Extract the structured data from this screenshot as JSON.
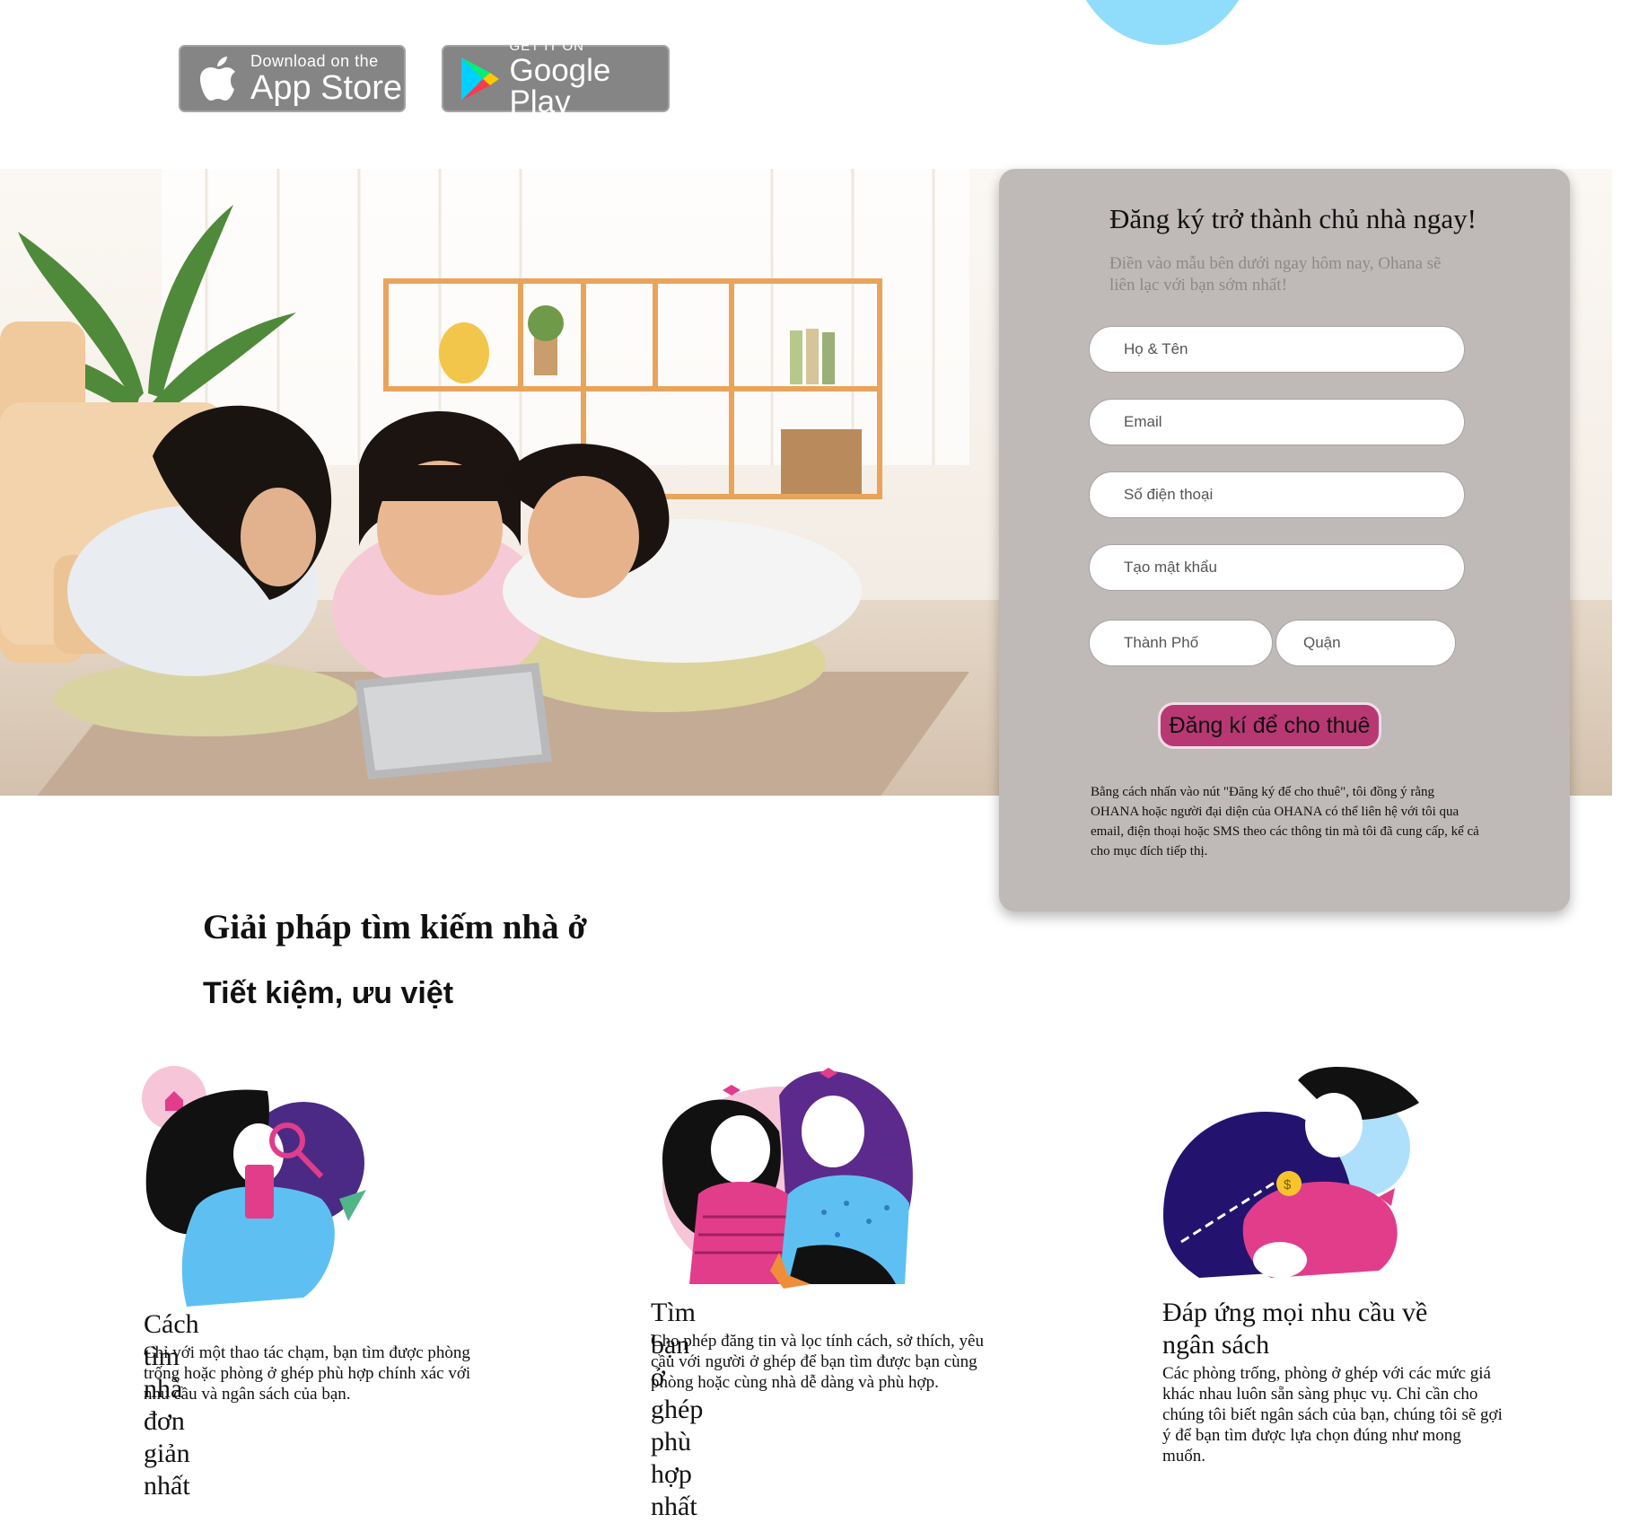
{
  "store_badges": {
    "app_store": {
      "small": "Download on the",
      "big": "App Store"
    },
    "google_play": {
      "small": "GET IT ON",
      "big": "Google Play"
    }
  },
  "signup": {
    "title": "Đăng ký trở thành chủ nhà ngay!",
    "subtitle": "Điền vào mẫu bên dưới ngay hôm nay, Ohana sẽ liên lạc với bạn sớm nhất!",
    "fields": {
      "name_placeholder": "Họ & Tên",
      "email_placeholder": "Email",
      "phone_placeholder": "Số điện thoại",
      "password_placeholder": "Tạo mật khẩu",
      "city_placeholder": "Thành Phố",
      "district_placeholder": "Quận"
    },
    "submit_label": "Đăng kí để cho thuê",
    "terms": "Bằng cách nhấn vào nút \"Đăng ký để cho thuê\", tôi đồng ý rằng OHANA hoặc người đại diện của OHANA có thể liên hệ với tôi qua email, điện thoại hoặc SMS theo các thông tin mà tôi đã cung cấp, kể cả cho mục đích tiếp thị."
  },
  "section": {
    "heading": "Giải pháp tìm kiếm nhà ở",
    "subheading": "Tiết kiệm, ưu việt"
  },
  "features": [
    {
      "title": "Cách tìm nhà đơn giản nhất",
      "text": "Chỉ với một thao tác chạm, bạn tìm được phòng trống hoặc phòng ở ghép phù hợp chính xác với nhu cầu và ngân sách của bạn."
    },
    {
      "title": "Tìm bạn ở ghép phù hợp nhất",
      "text": "Cho phép đăng tin và lọc tính cách, sở thích, yêu cầu với người ở ghép để bạn tìm được bạn cùng phòng hoặc cùng nhà dễ dàng và phù hợp."
    },
    {
      "title": "Đáp ứng mọi nhu cầu về ngân sách",
      "text": "Các phòng trống, phòng ở ghép với các mức giá khác nhau luôn sẵn sàng phục vụ. Chỉ cần cho chúng tôi biết ngân sách của bạn, chúng tôi sẽ gợi ý để bạn tìm được lựa chọn đúng như mong muốn."
    }
  ],
  "colors": {
    "card_bg": "#bfb9b8",
    "submit_bg": "#b83873",
    "badge_bg": "#858585",
    "accent_blue": "#8fdcfb",
    "accent_pink": "#e23d8a"
  }
}
